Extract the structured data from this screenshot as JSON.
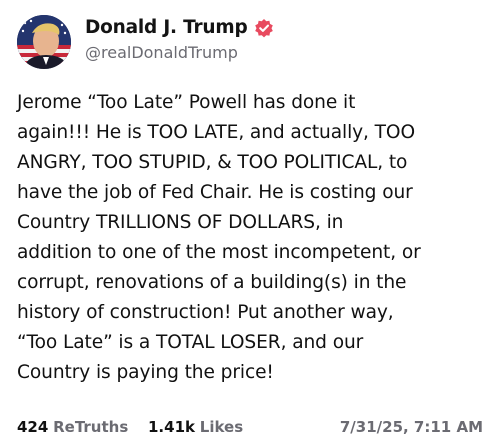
{
  "author": {
    "display_name": "Donald J. Trump",
    "handle": "@realDonaldTrump",
    "verified_icon": "verified-badge-icon",
    "verified_color": "#e84a5f"
  },
  "post": {
    "text": "Jerome “Too Late” Powell has done it\nagain!!! He is TOO LATE, and actually, TOO\nANGRY, TOO STUPID, & TOO POLITICAL, to\nhave the job of Fed Chair. He is costing our\nCountry TRILLIONS OF DOLLARS, in\naddition to one of the most incompetent, or\ncorrupt, renovations of a building(s) in the\nhistory of construction! Put another way,\n“Too Late” is a TOTAL LOSER, and our\nCountry is paying the price!"
  },
  "stats": {
    "retruths_count": "424",
    "retruths_label": "ReTruths",
    "likes_count": "1.41k",
    "likes_label": "Likes"
  },
  "timestamp": "7/31/25, 7:11 AM"
}
